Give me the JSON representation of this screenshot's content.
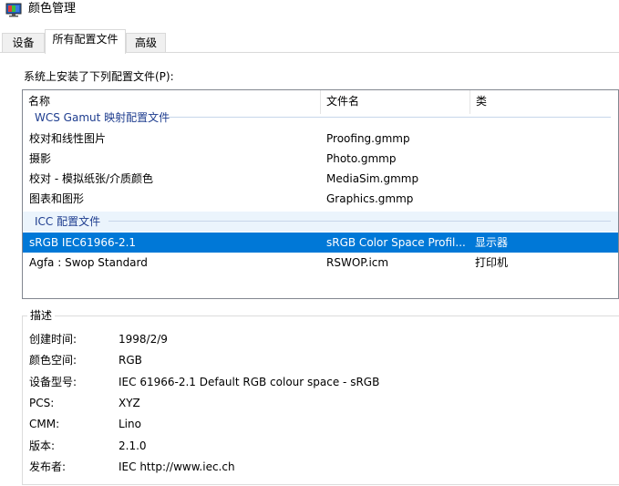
{
  "window": {
    "title": "颜色管理",
    "icon": "monitor-color-icon"
  },
  "tabs": [
    {
      "label": "设备",
      "active": false
    },
    {
      "label": "所有配置文件",
      "active": true
    },
    {
      "label": "高级",
      "active": false
    }
  ],
  "installed_label": "系统上安装了下列配置文件(P):",
  "list": {
    "columns": [
      "名称",
      "文件名",
      "类"
    ],
    "groups": [
      {
        "title": "WCS Gamut 映射配置文件",
        "rows": [
          {
            "name": "校对和线性图片",
            "file": "Proofing.gmmp",
            "type": ""
          },
          {
            "name": "摄影",
            "file": "Photo.gmmp",
            "type": ""
          },
          {
            "name": "校对 - 模拟纸张/介质颜色",
            "file": "MediaSim.gmmp",
            "type": ""
          },
          {
            "name": "图表和图形",
            "file": "Graphics.gmmp",
            "type": ""
          }
        ]
      },
      {
        "title": "ICC 配置文件",
        "rows": [
          {
            "name": "sRGB IEC61966-2.1",
            "file": "sRGB Color Space Profil...",
            "type": "显示器",
            "selected": true
          },
          {
            "name": "Agfa : Swop Standard",
            "file": "RSWOP.icm",
            "type": "打印机"
          }
        ]
      }
    ]
  },
  "description": {
    "title": "描述",
    "fields": [
      {
        "label": "创建时间:",
        "value": "1998/2/9"
      },
      {
        "label": "颜色空间:",
        "value": "RGB"
      },
      {
        "label": "设备型号:",
        "value": "IEC 61966-2.1 Default RGB colour space - sRGB"
      },
      {
        "label": "PCS:",
        "value": "XYZ"
      },
      {
        "label": "CMM:",
        "value": "Lino"
      },
      {
        "label": "版本:",
        "value": "2.1.0"
      },
      {
        "label": "发布者:",
        "value": "IEC http://www.iec.ch"
      }
    ]
  },
  "colors": {
    "selection": "#0078d7",
    "group_title": "#1e3d8f",
    "group_shade": "#ebf4fc"
  }
}
